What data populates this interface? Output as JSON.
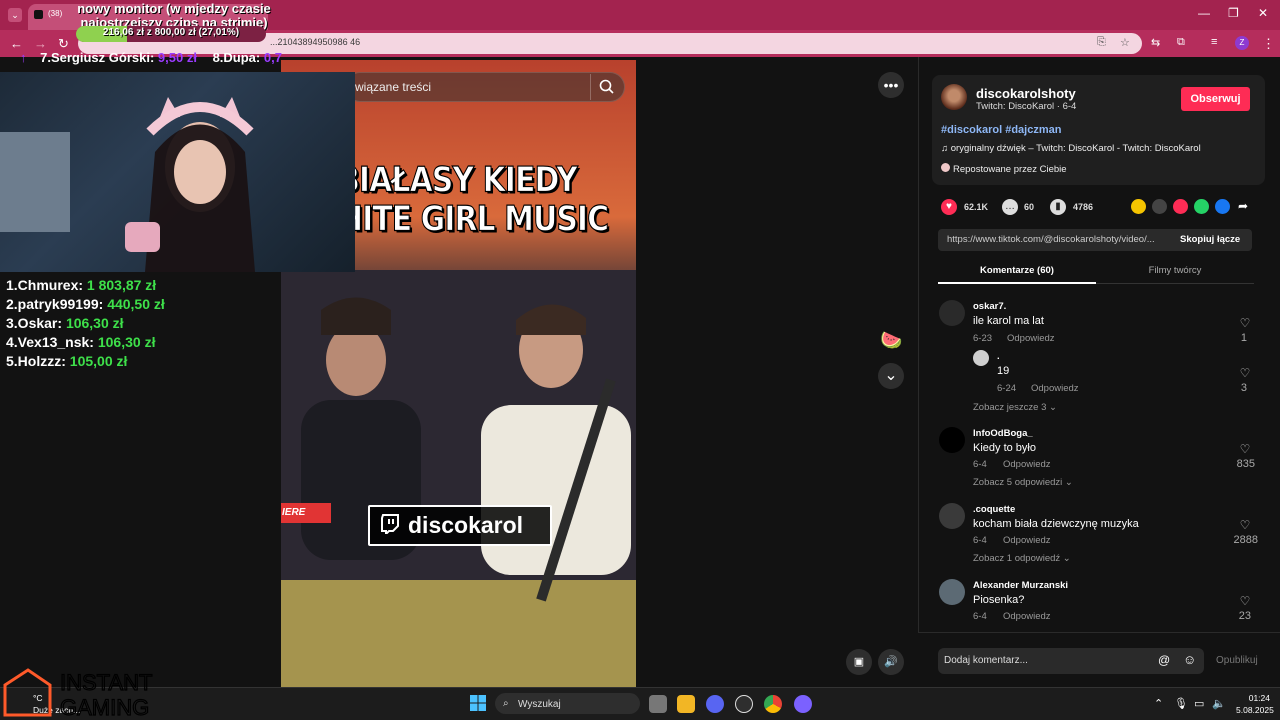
{
  "browser": {
    "tab_count": "(38)",
    "tab_title": "zoom",
    "url": "...21043894950986 46"
  },
  "stream": {
    "goal_title": "nowy monitor (w mjedzy czasie najostrzejszy czips na strimie)",
    "goal_amount": "216,06 zł z 800,00 zł (27,01%)",
    "goal_progress": 0.2701,
    "ticker": [
      {
        "name": "7.Sergiusz Górski:",
        "amount": "9,50 zł"
      },
      {
        "name": "8.Dupa:",
        "amount": "0,7"
      }
    ],
    "donors": [
      {
        "name": "1.Chmurex:",
        "amount": "1 803,87 zł"
      },
      {
        "name": "2.patryk99199:",
        "amount": "440,50 zł"
      },
      {
        "name": "3.Oskar:",
        "amount": "106,30 zł"
      },
      {
        "name": "4.Vex13_nsk:",
        "amount": "106,30 zł"
      },
      {
        "name": "5.Holzzz:",
        "amount": "105,00 zł"
      }
    ],
    "sponsor_line1": "INSTANT",
    "sponsor_line2": "GAMING"
  },
  "video": {
    "search_placeholder": "wiązane treści",
    "caption_line1": "BIAŁASY KIEDY",
    "caption_line2": "WHITE GIRL MUSIC",
    "twitch_name": "discokarol",
    "red_label": "IERE"
  },
  "post": {
    "author": "discokarolshoty",
    "author_sub": "Twitch: DiscoKarol · 6-4",
    "follow_label": "Obserwuj",
    "hashtags": "#discokarol #dajczman",
    "music": "oryginalny dźwięk – Twitch: DiscoKarol - Twitch: DiscoKarol",
    "repost": "Repostowane przez Ciebie",
    "likes": "62.1K",
    "comments": "60",
    "saves": "4786",
    "link": "https://www.tiktok.com/@discokarolshoty/video/...",
    "copy_label": "Skopiuj łącze",
    "tab_comments": "Komentarze (60)",
    "tab_creator": "Filmy twórcy"
  },
  "comments": [
    {
      "user": "oskar7.",
      "text": "ile karol ma lat",
      "date": "6-23",
      "reply": "Odpowiedz",
      "likes": "1"
    },
    {
      "user": ".",
      "text": "19",
      "date": "6-24",
      "reply": "Odpowiedz",
      "likes": "3"
    },
    {
      "more": "Zobacz jeszcze 3"
    },
    {
      "user": "InfoOdBoga_",
      "text": "Kiedy to było",
      "date": "6-4",
      "reply": "Odpowiedz",
      "likes": "835"
    },
    {
      "more": "Zobacz 5 odpowiedzi"
    },
    {
      "user": ".coquette",
      "text": "kocham biała dziewczynę muzyka",
      "date": "6-4",
      "reply": "Odpowiedz",
      "likes": "2888"
    },
    {
      "more": "Zobacz 1 odpowiedź"
    },
    {
      "user": "Alexander Murzanski",
      "text": "Piosenka?",
      "date": "6-4",
      "reply": "Odpowiedz",
      "likes": "23"
    }
  ],
  "comment_box": {
    "placeholder": "Dodaj komentarz...",
    "publish": "Opublikuj"
  },
  "taskbar": {
    "weather_temp": "°C",
    "weather_text": "Duże zach...",
    "search": "Wyszukaj",
    "time": "01:24",
    "date": "5.08.2025"
  },
  "colors": {
    "accent": "#fe2c55",
    "donor_amount": "#3ee04a",
    "hashtag": "#8eb7f5"
  }
}
